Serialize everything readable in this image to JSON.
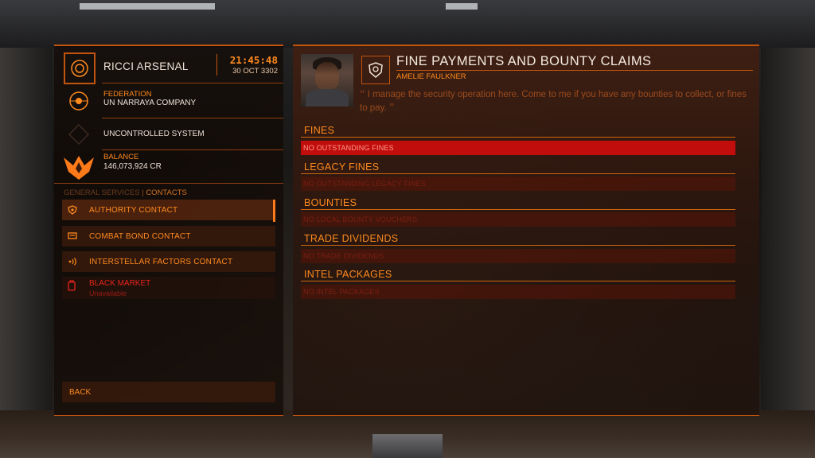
{
  "station": {
    "name": "RICCI ARSENAL",
    "time": "21:45:48",
    "date": "30 OCT 3302",
    "faction_label": "FEDERATION",
    "faction_name": "UN NARRAYA COMPANY",
    "system_status": "UNCONTROLLED SYSTEM",
    "balance_label": "BALANCE",
    "balance_value": "146,073,924 CR"
  },
  "services": {
    "general_label": "GENERAL SERVICES",
    "separator": "|",
    "contacts_label": "CONTACTS",
    "items": [
      {
        "label": "AUTHORITY CONTACT",
        "icon": "authority-icon"
      },
      {
        "label": "COMBAT BOND CONTACT",
        "icon": "combat-bond-icon"
      },
      {
        "label": "INTERSTELLAR FACTORS CONTACT",
        "icon": "interstellar-icon"
      }
    ],
    "black_market": {
      "label": "BLACK MARKET",
      "status": "Unavailable"
    },
    "back_label": "BACK"
  },
  "main": {
    "title": "FINE PAYMENTS AND BOUNTY CLAIMS",
    "contact_name": "AMELIE FAULKNER",
    "quote": "I manage the security operation here. Come to me if you have any bounties to collect, or fines to pay.",
    "sections": [
      {
        "title": "FINES",
        "status": "NO OUTSTANDING FINES"
      },
      {
        "title": "LEGACY FINES",
        "status": "NO OUTSTANDING LEGACY FINES"
      },
      {
        "title": "BOUNTIES",
        "status": "NO LOCAL BOUNTY VOUCHERS"
      },
      {
        "title": "TRADE DIVIDENDS",
        "status": "NO TRADE DIVIDENDS"
      },
      {
        "title": "INTEL PACKAGES",
        "status": "NO INTEL PACKAGES"
      }
    ]
  },
  "colors": {
    "accent": "#ff8a1e",
    "border": "#c2540e",
    "alert": "#c20d0d",
    "danger_text": "#e5241b"
  }
}
